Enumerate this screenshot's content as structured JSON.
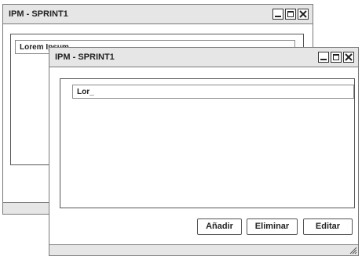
{
  "background_window": {
    "title": "IPM - SPRINT1",
    "input_value": "Lorem Ipsum"
  },
  "foreground_window": {
    "title": "IPM - SPRINT1",
    "input_value": "Lor_",
    "buttons": {
      "add_label": "Añadir",
      "delete_label": "Eliminar",
      "edit_label": "Editar"
    }
  },
  "icons": {
    "minimize": "minimize-icon",
    "maximize": "maximize-icon",
    "close": "close-icon",
    "resize_grip": "resize-grip-icon"
  },
  "colors": {
    "titlebar": "#e6e6e6",
    "border": "#7a7a7a",
    "text": "#222222"
  }
}
